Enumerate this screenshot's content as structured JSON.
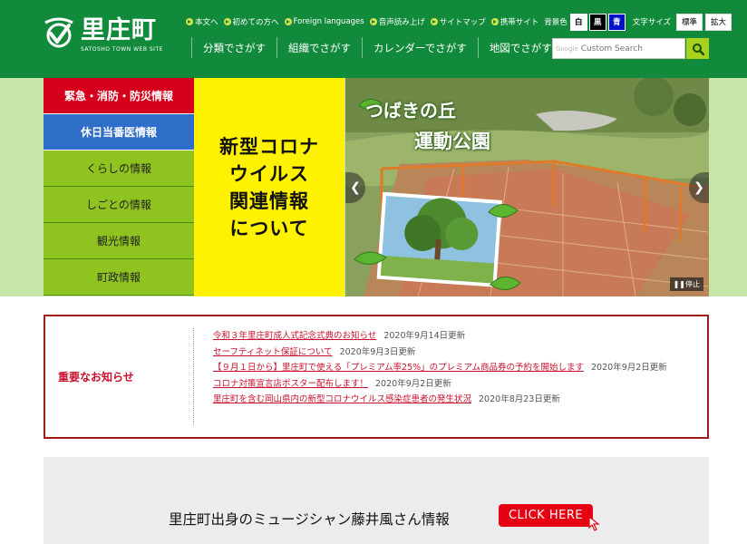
{
  "header": {
    "logo_title": "里庄町",
    "logo_subtitle": "SATOSHO TOWN WEB SITE",
    "util_links": [
      "本文へ",
      "初めての方へ",
      "Foreign languages",
      "音声読み上げ",
      "サイトマップ",
      "携帯サイト"
    ],
    "bg_color_label": "背景色",
    "bg_colors": [
      "白",
      "黒",
      "青"
    ],
    "font_size_label": "文字サイズ",
    "font_sizes": [
      "標準",
      "拡大"
    ],
    "nav": [
      "分類でさがす",
      "組織でさがす",
      "カレンダーでさがす",
      "地図でさがす"
    ],
    "search_google": "Google",
    "search_placeholder": "Custom Search"
  },
  "side_menu": [
    {
      "label": "緊急・消防・防災情報",
      "style": "red"
    },
    {
      "label": "休日当番医情報",
      "style": "blue"
    },
    {
      "label": "くらしの情報",
      "style": "green"
    },
    {
      "label": "しごとの情報",
      "style": "green"
    },
    {
      "label": "観光情報",
      "style": "green"
    },
    {
      "label": "町政情報",
      "style": "green"
    }
  ],
  "corona_banner": {
    "line1": "新型コロナ",
    "line2": "ウイルス",
    "line3": "関連情報",
    "line4": "について"
  },
  "slider": {
    "title_line1": "つばきの丘",
    "title_line2": "運動公園",
    "pause_label": "停止"
  },
  "notices": {
    "title": "重要なお知らせ",
    "items": [
      {
        "text": "令和３年里庄町成人式記念式典のお知らせ",
        "date": "2020年9月14日更新"
      },
      {
        "text": "セーフティネット保証について",
        "date": "2020年9月3日更新"
      },
      {
        "text": "【９月１日から】里庄町で使える「プレミアム率25%」のプレミアム商品券の予約を開始します",
        "date": "2020年9月2日更新"
      },
      {
        "text": "コロナ対策宣言店ポスター配布します！",
        "date": "2020年9月2日更新"
      },
      {
        "text": "里庄町を含む岡山県内の新型コロナウイルス感染症患者の発生状況",
        "date": "2020年8月23日更新"
      }
    ]
  },
  "banner": {
    "text": "里庄町出身のミュージシャン藤井風さん情報",
    "button": "CLICK HERE"
  },
  "colors": {
    "header_green": "#128a3b",
    "menu_red": "#d6001c",
    "menu_blue": "#2e6dc8",
    "menu_green": "#8fc31f",
    "corona_yellow": "#fff200",
    "notice_red": "#c8102e"
  }
}
